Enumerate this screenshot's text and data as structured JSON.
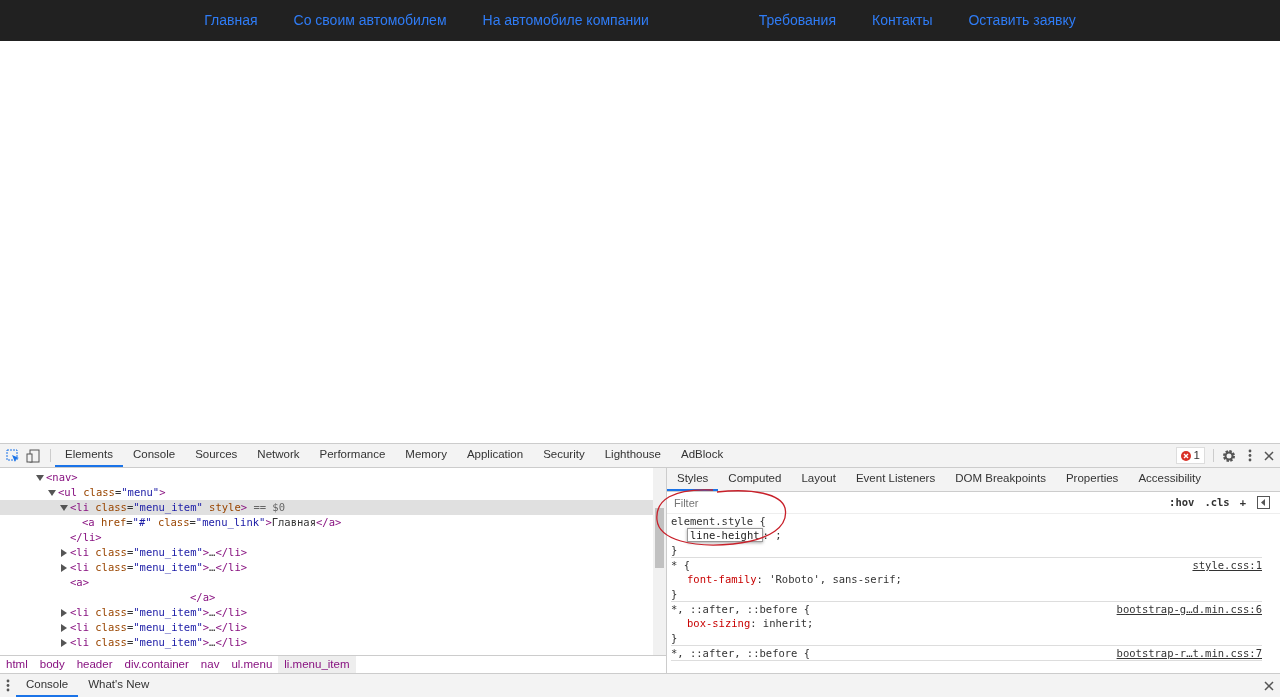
{
  "site_nav": {
    "items": [
      {
        "label": "Главная"
      },
      {
        "label": "Со своим автомобилем"
      },
      {
        "label": "На автомобиле компании"
      },
      {
        "label": "Требования"
      },
      {
        "label": "Контакты"
      },
      {
        "label": "Оставить заявку"
      }
    ]
  },
  "devtools": {
    "tabs": [
      {
        "label": "Elements",
        "selected": true
      },
      {
        "label": "Console",
        "selected": false
      },
      {
        "label": "Sources",
        "selected": false
      },
      {
        "label": "Network",
        "selected": false
      },
      {
        "label": "Performance",
        "selected": false
      },
      {
        "label": "Memory",
        "selected": false
      },
      {
        "label": "Application",
        "selected": false
      },
      {
        "label": "Security",
        "selected": false
      },
      {
        "label": "Lighthouse",
        "selected": false
      },
      {
        "label": "AdBlock",
        "selected": false
      }
    ],
    "error_count": "1",
    "dom_tree": [
      {
        "markup": "<nav>",
        "expanded": true,
        "selected": false,
        "children": [
          {
            "markup": "<ul class=\"menu\">",
            "expanded": true,
            "selected": false,
            "children": [
              {
                "markup": "<li class=\"menu_item\" style>",
                "suffix": "== $0",
                "expanded": true,
                "selected": true,
                "closing": "</li>",
                "children": [
                  {
                    "markup": "<a href=\"#\" class=\"menu_link\">Главная</a>",
                    "kind": "leaf"
                  }
                ]
              },
              {
                "markup": "<li class=\"menu_item\">…</li>",
                "expanded": false,
                "selected": false
              },
              {
                "markup": "<li class=\"menu_item\">…</li>",
                "expanded": false,
                "selected": false
              },
              {
                "markup": "<a>",
                "kind": "leaf"
              },
              {
                "markup": "</a>",
                "kind": "stray"
              },
              {
                "markup": "<li class=\"menu_item\">…</li>",
                "expanded": false,
                "selected": false
              },
              {
                "markup": "<li class=\"menu_item\">…</li>",
                "expanded": false,
                "selected": false
              },
              {
                "markup": "<li class=\"menu_item\">…</li>",
                "expanded": false,
                "selected": false
              }
            ]
          }
        ]
      }
    ],
    "breadcrumbs": [
      {
        "label": "html",
        "selected": false
      },
      {
        "label": "body",
        "selected": false
      },
      {
        "label": "header",
        "selected": false
      },
      {
        "label": "div.container",
        "selected": false
      },
      {
        "label": "nav",
        "selected": false
      },
      {
        "label": "ul.menu",
        "selected": false
      },
      {
        "label": "li.menu_item",
        "selected": true
      }
    ],
    "side_tabs": [
      {
        "label": "Styles",
        "selected": true
      },
      {
        "label": "Computed",
        "selected": false
      },
      {
        "label": "Layout",
        "selected": false
      },
      {
        "label": "Event Listeners",
        "selected": false
      },
      {
        "label": "DOM Breakpoints",
        "selected": false
      },
      {
        "label": "Properties",
        "selected": false
      },
      {
        "label": "Accessibility",
        "selected": false
      }
    ],
    "filter": {
      "placeholder": "Filter"
    },
    "filter_buttons": [
      ":hov",
      ".cls",
      "+"
    ],
    "rules": [
      {
        "selector": "element.style {",
        "close": "}",
        "declarations": [
          {
            "prop": "line-height",
            "value": ": ;",
            "editing": true
          }
        ]
      },
      {
        "selector": "* {",
        "source": "style.css:1",
        "close": "}",
        "declarations": [
          {
            "prop": "font-family",
            "value": ": 'Roboto', sans-serif;",
            "editing": false
          }
        ]
      },
      {
        "selector": "*, ::after, ::before {",
        "source": "bootstrap-g…d.min.css:6",
        "close": "}",
        "declarations": [
          {
            "prop": "box-sizing",
            "value": ": inherit;",
            "editing": false
          }
        ]
      },
      {
        "selector": "*, ::after, ::before {",
        "source": "bootstrap-r…t.min.css:7"
      }
    ],
    "drawer_tabs": [
      {
        "label": "Console",
        "selected": true
      },
      {
        "label": "What's New",
        "selected": false
      }
    ]
  }
}
